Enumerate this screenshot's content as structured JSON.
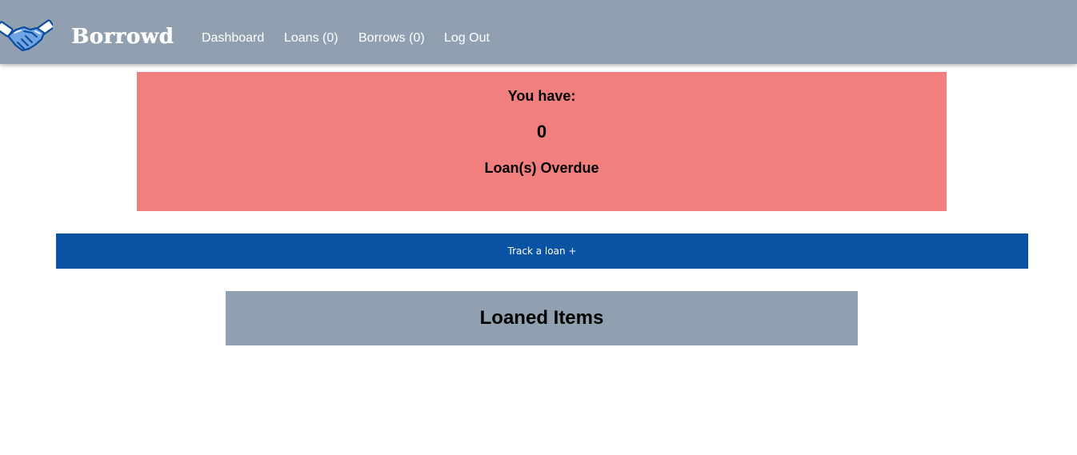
{
  "navbar": {
    "logo_icon": "handshake-icon",
    "brand": "Borrowd",
    "links": {
      "dashboard": "Dashboard",
      "loans": "Loans (0)",
      "borrows": "Borrows (0)",
      "logout": "Log Out"
    }
  },
  "overdue": {
    "heading": "You have:",
    "count": "0",
    "label": "Loan(s) Overdue"
  },
  "track_button": {
    "label": "Track a loan +"
  },
  "loaned_items": {
    "title": "Loaned Items"
  },
  "colors": {
    "navbar": "#91a0b0",
    "overdue_bg": "#f07f7d",
    "primary_button": "#0a52a2",
    "section_header": "#91a0b0"
  }
}
